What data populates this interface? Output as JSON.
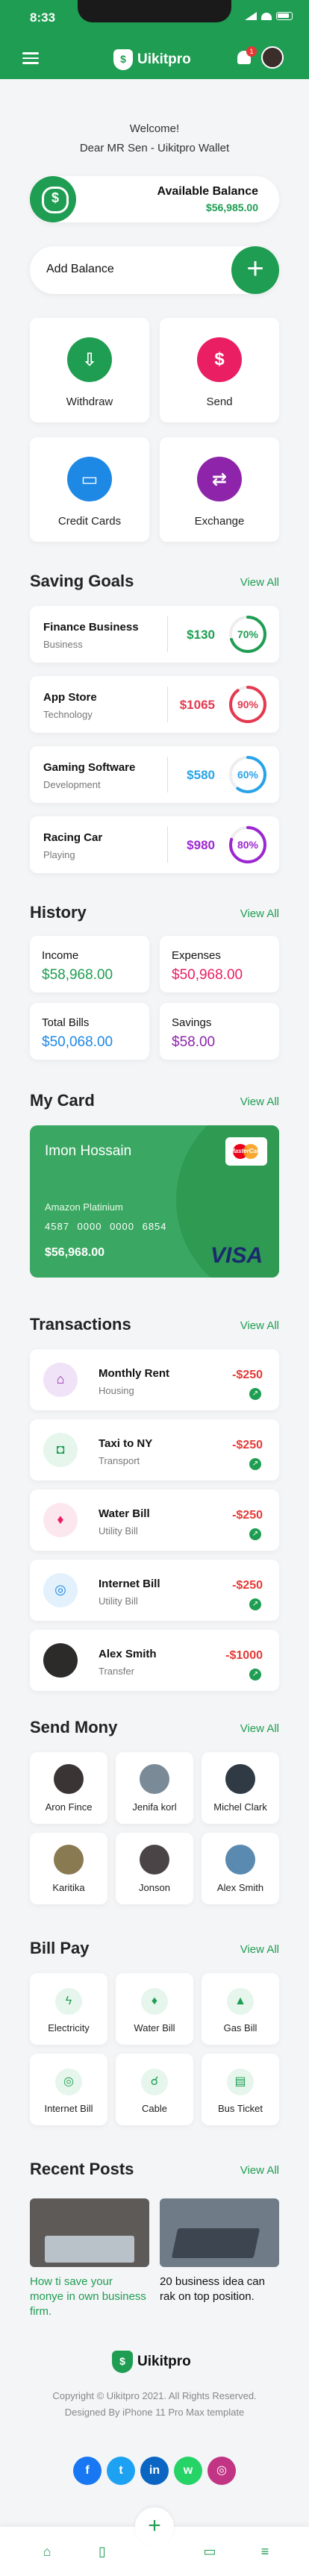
{
  "status": {
    "time": "8:33"
  },
  "app": {
    "name": "Uikitpro",
    "notification_count": "1"
  },
  "welcome": {
    "line1": "Welcome!",
    "line2": "Dear MR Sen - Uikitpro Wallet"
  },
  "balance": {
    "label": "Available Balance",
    "value": "$56,985.00",
    "add_label": "Add Balance",
    "add_icon": "+"
  },
  "actions": [
    {
      "label": "Withdraw",
      "icon": "withdraw-icon",
      "color": "#1f9d52"
    },
    {
      "label": "Send",
      "icon": "send-icon",
      "color": "#e91e63"
    },
    {
      "label": "Credit Cards",
      "icon": "credit-card-icon",
      "color": "#1e88e5"
    },
    {
      "label": "Exchange",
      "icon": "exchange-icon",
      "color": "#8e24aa"
    }
  ],
  "saving_goals": {
    "title": "Saving Goals",
    "view_all": "View All",
    "items": [
      {
        "name": "Finance Business",
        "category": "Business",
        "amount": "$130",
        "percent": "70%",
        "progress": 0.7,
        "color": "#1f9d52"
      },
      {
        "name": "App Store",
        "category": "Technology",
        "amount": "$1065",
        "percent": "90%",
        "progress": 0.9,
        "color": "#e53950"
      },
      {
        "name": "Gaming Software",
        "category": "Development",
        "amount": "$580",
        "percent": "60%",
        "progress": 0.6,
        "color": "#29a3e8"
      },
      {
        "name": "Racing Car",
        "category": "Playing",
        "amount": "$980",
        "percent": "80%",
        "progress": 0.8,
        "color": "#9c27d0"
      }
    ]
  },
  "history": {
    "title": "History",
    "view_all": "View All",
    "items": [
      {
        "label": "Income",
        "value": "$58,968.00",
        "color": "#1f9d52"
      },
      {
        "label": "Expenses",
        "value": "$50,968.00",
        "color": "#e91e63"
      },
      {
        "label": "Total Bills",
        "value": "$50,068.00",
        "color": "#1e88e5"
      },
      {
        "label": "Savings",
        "value": "$58.00",
        "color": "#8e24aa"
      }
    ]
  },
  "my_card": {
    "title": "My Card",
    "view_all": "View All",
    "holder": "Imon Hossain",
    "bank": "Amazon Platinium",
    "number": "4587 0000 0000 6854",
    "balance": "$56,968.00",
    "brand": "VISA",
    "network_label": "MasterCard"
  },
  "transactions": {
    "title": "Transactions",
    "view_all": "View All",
    "items": [
      {
        "title": "Monthly Rent",
        "sub": "Housing",
        "amount": "-$250",
        "icon": "house-icon",
        "glyph": "⌂",
        "bg": "#f1e3f7",
        "fg": "#8e24aa"
      },
      {
        "title": "Taxi to NY",
        "sub": "Transport",
        "amount": "-$250",
        "icon": "taxi-icon",
        "glyph": "◘",
        "bg": "#e6f6ec",
        "fg": "#1f9d52"
      },
      {
        "title": "Water Bill",
        "sub": "Utility Bill",
        "amount": "-$250",
        "icon": "water-drop-icon",
        "glyph": "♦",
        "bg": "#fde7ee",
        "fg": "#e91e63"
      },
      {
        "title": "Internet Bill",
        "sub": "Utility Bill",
        "amount": "-$250",
        "icon": "globe-icon",
        "glyph": "◎",
        "bg": "#e3f1fd",
        "fg": "#1e88e5"
      },
      {
        "title": "Alex Smith",
        "sub": "Transfer",
        "amount": "-$1000",
        "icon": "avatar",
        "glyph": "",
        "bg": "#2d2a2a",
        "fg": "#fff"
      }
    ]
  },
  "send_money": {
    "title": "Send Mony",
    "view_all": "View All",
    "people": [
      {
        "name": "Aron Fince",
        "color": "#3a3434"
      },
      {
        "name": "Jenifa korl",
        "color": "#7a8a96"
      },
      {
        "name": "Michel Clark",
        "color": "#2f3a44"
      },
      {
        "name": "Karitika",
        "color": "#8a7a52"
      },
      {
        "name": "Jonson",
        "color": "#4a4446"
      },
      {
        "name": "Alex Smith",
        "color": "#5a8ab0"
      }
    ]
  },
  "bill_pay": {
    "title": "Bill Pay",
    "view_all": "View All",
    "items": [
      {
        "name": "Electricity",
        "icon": "lightning-icon",
        "glyph": "ϟ"
      },
      {
        "name": "Water Bill",
        "icon": "water-drop-icon",
        "glyph": "♦"
      },
      {
        "name": "Gas Bill",
        "icon": "flame-icon",
        "glyph": "▲"
      },
      {
        "name": "Internet Bill",
        "icon": "globe-icon",
        "glyph": "◎"
      },
      {
        "name": "Cable",
        "icon": "cable-icon",
        "glyph": "☌"
      },
      {
        "name": "Bus Ticket",
        "icon": "ticket-icon",
        "glyph": "▤"
      }
    ]
  },
  "recent_posts": {
    "title": "Recent Posts",
    "view_all": "View All",
    "items": [
      {
        "title": "How ti save your monye in own business firm.",
        "color": "#1f9d52",
        "img_color": "#5e5a58"
      },
      {
        "title": "20 business idea can rak on top position.",
        "color": "#111111",
        "img_color": "#6f7c88"
      }
    ]
  },
  "footer": {
    "brand": "Uikitpro",
    "copyright": "Copyright © Uikitpro 2021. All Rights Reserved. Designed By iPhone 11 Pro Max template",
    "socials": [
      {
        "label": "f",
        "icon": "facebook-icon",
        "color": "#1877f2"
      },
      {
        "label": "t",
        "icon": "twitter-icon",
        "color": "#1da1f2"
      },
      {
        "label": "in",
        "icon": "linkedin-icon",
        "color": "#0a66c2"
      },
      {
        "label": "w",
        "icon": "whatsapp-icon",
        "color": "#25d366"
      },
      {
        "label": "◎",
        "icon": "instagram-icon",
        "color": "#c13584"
      }
    ]
  },
  "theme": {
    "primary": "#1f9d52",
    "danger": "#e53935"
  }
}
